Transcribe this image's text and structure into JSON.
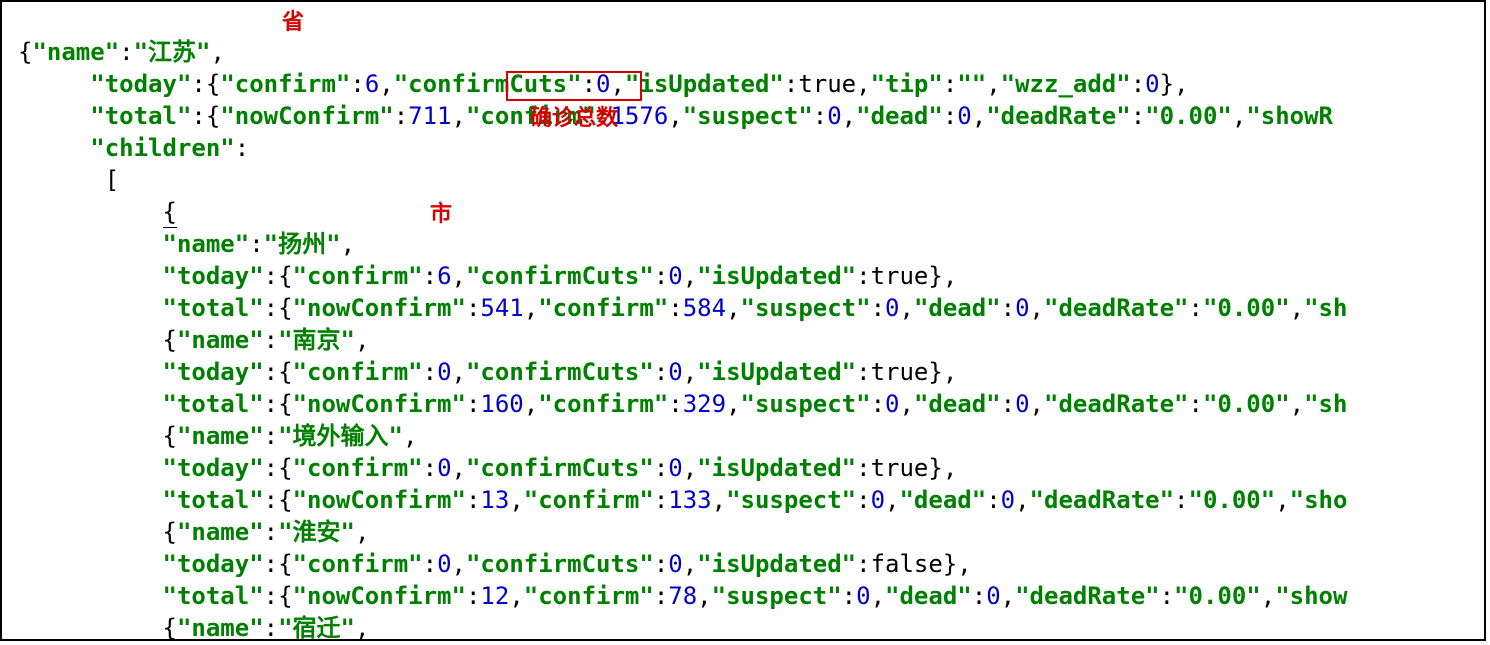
{
  "annotations": {
    "province_label": "省",
    "city_label": "市",
    "confirm_total_label": "确诊总数"
  },
  "root": {
    "name_key": "\"name\"",
    "name_val": "\"江苏\"",
    "today_key": "\"today\"",
    "today_confirm_key": "\"confirm\"",
    "today_confirm_val": "6",
    "today_confirmCuts_key": "\"confirmCuts\"",
    "today_confirmCuts_val": "0",
    "today_isUpdated_key": "\"isUpdated\"",
    "today_isUpdated_val": "true",
    "today_tip_key": "\"tip\"",
    "today_tip_val": "\"\"",
    "today_wzz_key": "\"wzz_add\"",
    "today_wzz_val": "0",
    "total_key": "\"total\"",
    "total_nowConfirm_key": "\"nowConfirm\"",
    "total_nowConfirm_val": "711",
    "total_confirm_key": "\"confirm\"",
    "total_confirm_val": "1576",
    "total_suspect_key": "\"suspect\"",
    "total_suspect_val": "0",
    "total_dead_key": "\"dead\"",
    "total_dead_val": "0",
    "total_deadRate_key": "\"deadRate\"",
    "total_deadRate_val": "\"0.00\"",
    "total_show_key": "\"showR",
    "children_key": "\"children\""
  },
  "children": [
    {
      "name_val": "\"扬州\"",
      "today_confirm_val": "6",
      "today_confirmCuts_val": "0",
      "today_isUpdated_val": "true",
      "total_nowConfirm_val": "541",
      "total_confirm_val": "584",
      "total_suspect_val": "0",
      "total_dead_val": "0",
      "total_deadRate_val": "\"0.00\"",
      "total_tail": "\"sh"
    },
    {
      "name_val": "\"南京\"",
      "today_confirm_val": "0",
      "today_confirmCuts_val": "0",
      "today_isUpdated_val": "true",
      "total_nowConfirm_val": "160",
      "total_confirm_val": "329",
      "total_suspect_val": "0",
      "total_dead_val": "0",
      "total_deadRate_val": "\"0.00\"",
      "total_tail": "\"sh"
    },
    {
      "name_val": "\"境外输入\"",
      "today_confirm_val": "0",
      "today_confirmCuts_val": "0",
      "today_isUpdated_val": "true",
      "total_nowConfirm_val": "13",
      "total_confirm_val": "133",
      "total_suspect_val": "0",
      "total_dead_val": "0",
      "total_deadRate_val": "\"0.00\"",
      "total_tail": "\"sho"
    },
    {
      "name_val": "\"淮安\"",
      "today_confirm_val": "0",
      "today_confirmCuts_val": "0",
      "today_isUpdated_val": "false",
      "total_nowConfirm_val": "12",
      "total_confirm_val": "78",
      "total_suspect_val": "0",
      "total_dead_val": "0",
      "total_deadRate_val": "\"0.00\"",
      "total_tail": "\"show"
    },
    {
      "name_val": "\"宿迁\""
    }
  ],
  "keys": {
    "name": "\"name\"",
    "today": "\"today\"",
    "confirm": "\"confirm\"",
    "confirmCuts": "\"confirmCuts\"",
    "isUpdated": "\"isUpdated\"",
    "total": "\"total\"",
    "nowConfirm": "\"nowConfirm\"",
    "suspect": "\"suspect\"",
    "dead": "\"dead\"",
    "deadRate": "\"deadRate\""
  }
}
